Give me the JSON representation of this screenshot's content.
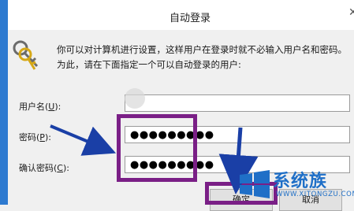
{
  "dialog": {
    "title": "自动登录",
    "close_glyph": "✕",
    "description": "你可以对计算机进行设置，这样用户在登录时就不必输入用户名和密码。为此，请在下面指定一个可以自动登录的用户:",
    "icon": "keys-icon"
  },
  "form": {
    "username": {
      "label": "用户名(",
      "mnemonic": "U",
      "label_end": "):",
      "value": ""
    },
    "password": {
      "label": "密码(",
      "mnemonic": "P",
      "label_end": "):",
      "masked_value": "●●●●●●●●●"
    },
    "confirm": {
      "label": "确认密码(",
      "mnemonic": "C",
      "label_end": "):",
      "masked_value": "●●●●●●●●●"
    }
  },
  "buttons": {
    "ok": "确定",
    "cancel": "取消"
  },
  "annotations": {
    "highlight_color": "#7a1f86",
    "arrow_color": "#1a3fa6"
  },
  "watermark": {
    "brand": "系统族",
    "url": "WWW.XITONGZU.COM"
  }
}
